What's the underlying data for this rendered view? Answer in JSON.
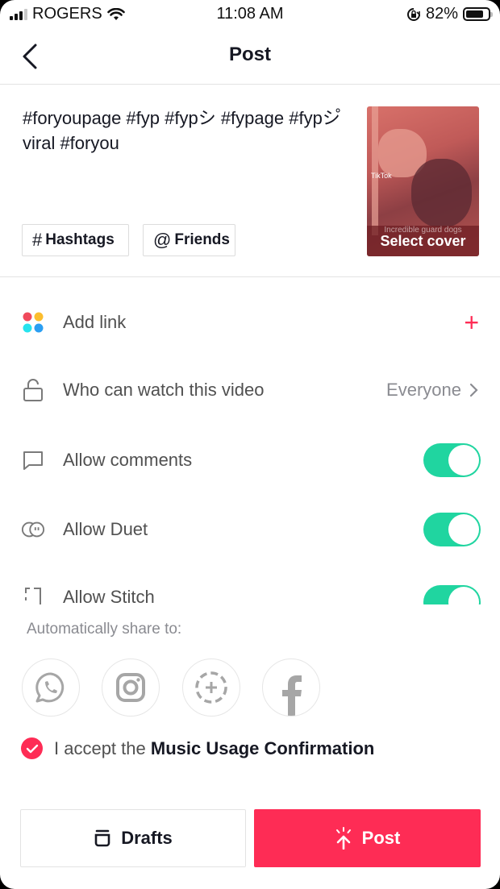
{
  "status_bar": {
    "carrier": "ROGERS",
    "time": "11:08 AM",
    "battery_percent_label": "82%",
    "battery_level": 0.82,
    "signal_bars_active": 3,
    "signal_bars_total": 4,
    "icons": [
      "signal-icon",
      "wifi-icon",
      "orientation-lock-icon",
      "battery-icon"
    ]
  },
  "nav": {
    "back_icon": "chevron-left-icon",
    "title": "Post"
  },
  "caption": {
    "text": "#foryoupage #fyp #fypシ #fypage #fypシ゚viral #foryou",
    "chips": [
      {
        "symbol": "#",
        "label": "Hashtags"
      },
      {
        "symbol": "@",
        "label": "Friends"
      }
    ]
  },
  "cover": {
    "video_caption": "Incredible guard dogs",
    "watermark": "TikTok",
    "select_label": "Select cover"
  },
  "settings": {
    "add_link": {
      "label": "Add link",
      "icon": "colored-dots-icon",
      "action_icon": "plus-icon"
    },
    "privacy": {
      "label": "Who can watch this video",
      "icon": "unlock-icon",
      "value": "Everyone"
    },
    "toggles": [
      {
        "label": "Allow comments",
        "icon": "comment-icon",
        "on": true
      },
      {
        "label": "Allow Duet",
        "icon": "duet-icon",
        "on": true
      },
      {
        "label": "Allow Stitch",
        "icon": "stitch-icon",
        "on": true
      }
    ]
  },
  "share": {
    "label": "Automatically share to:",
    "targets": [
      {
        "name": "WhatsApp",
        "icon": "whatsapp-icon"
      },
      {
        "name": "Instagram",
        "icon": "instagram-icon"
      },
      {
        "name": "Story",
        "icon": "story-add-icon"
      },
      {
        "name": "Facebook",
        "icon": "facebook-icon"
      }
    ]
  },
  "accept": {
    "checked": true,
    "prefix": "I accept the",
    "link": "Music Usage Confirmation"
  },
  "buttons": {
    "drafts": "Drafts",
    "post": "Post"
  },
  "colors": {
    "accent": "#fe2c55",
    "toggle_on": "#20d5a0",
    "text_primary": "#161823",
    "text_secondary": "#8a8b91"
  }
}
